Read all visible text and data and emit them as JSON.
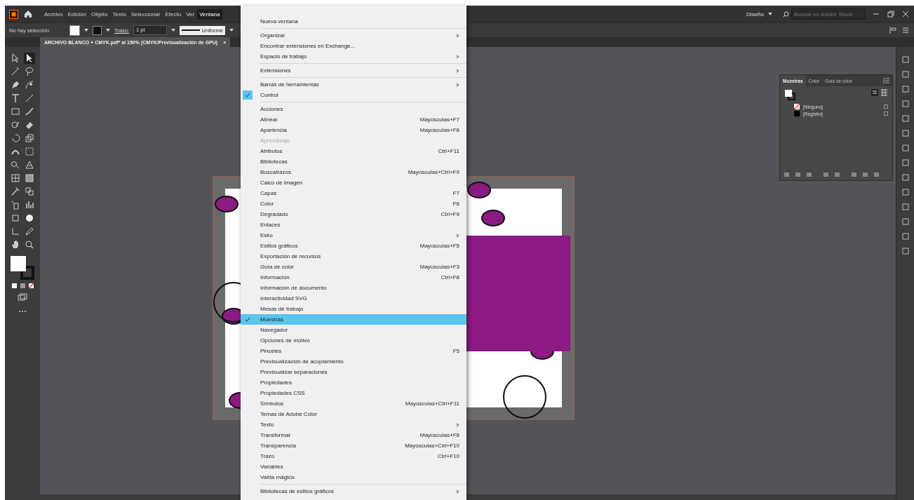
{
  "menubar": {
    "items": [
      {
        "label": "Archivo",
        "selected": false
      },
      {
        "label": "Edición",
        "selected": false
      },
      {
        "label": "Objeto",
        "selected": false
      },
      {
        "label": "Texto",
        "selected": false
      },
      {
        "label": "Seleccionar",
        "selected": false
      },
      {
        "label": "Efecto",
        "selected": false
      },
      {
        "label": "Ver",
        "selected": false
      },
      {
        "label": "Ventana",
        "selected": true
      }
    ],
    "workspace": "Diseño",
    "search": {
      "placeholder": "Buscar en Adobe Stock"
    }
  },
  "control_bar": {
    "selection": "No hay selección",
    "stroke_label": "Trazo:",
    "stroke_weight": "1 pt",
    "stroke_profile": "Uniforme"
  },
  "document_tab": {
    "title": "ARCHIVO BLANCO + CMYK.pdf* al 150% (CMYK/Previsualización de GPU)",
    "close": "×"
  },
  "swatches_panel": {
    "tabs": [
      {
        "label": "Muestras",
        "selected": true
      },
      {
        "label": "Color",
        "selected": false
      },
      {
        "label": "Guía de color",
        "selected": false
      }
    ],
    "swatches": [
      {
        "name": "[Ninguno]",
        "kind": "none"
      },
      {
        "name": "[Registro]",
        "kind": "registration"
      }
    ]
  },
  "window_menu": [
    {
      "kind": "item",
      "label": "Nueva ventana"
    },
    {
      "kind": "separator"
    },
    {
      "kind": "item",
      "label": "Organizar",
      "submenu": true
    },
    {
      "kind": "item",
      "label": "Encontrar extensiones en Exchange..."
    },
    {
      "kind": "item",
      "label": "Espacio de trabajo",
      "submenu": true
    },
    {
      "kind": "separator"
    },
    {
      "kind": "item",
      "label": "Extensiones",
      "submenu": true
    },
    {
      "kind": "separator"
    },
    {
      "kind": "item",
      "label": "Barras de herramientas",
      "submenu": true
    },
    {
      "kind": "item",
      "label": "Control",
      "checked": true
    },
    {
      "kind": "separator"
    },
    {
      "kind": "item",
      "label": "Acciones"
    },
    {
      "kind": "item",
      "label": "Alinear",
      "shortcut": "Mayúsculas+F7"
    },
    {
      "kind": "item",
      "label": "Apariencia",
      "shortcut": "Mayúsculas+F6"
    },
    {
      "kind": "item",
      "label": "Aprendizaje",
      "disabled": true
    },
    {
      "kind": "item",
      "label": "Atributos",
      "shortcut": "Ctrl+F11"
    },
    {
      "kind": "item",
      "label": "Bibliotecas"
    },
    {
      "kind": "item",
      "label": "Buscatrazos",
      "shortcut": "Mayúsculas+Ctrl+F9"
    },
    {
      "kind": "item",
      "label": "Calco de imagen"
    },
    {
      "kind": "item",
      "label": "Capas",
      "shortcut": "F7"
    },
    {
      "kind": "item",
      "label": "Color",
      "shortcut": "F6"
    },
    {
      "kind": "item",
      "label": "Degradado",
      "shortcut": "Ctrl+F9"
    },
    {
      "kind": "item",
      "label": "Enlaces"
    },
    {
      "kind": "item",
      "label": "Esko",
      "submenu": true
    },
    {
      "kind": "item",
      "label": "Estilos gráficos",
      "shortcut": "Mayúsculas+F5"
    },
    {
      "kind": "item",
      "label": "Exportación de recursos"
    },
    {
      "kind": "item",
      "label": "Guía de color",
      "shortcut": "Mayúsculas+F3"
    },
    {
      "kind": "item",
      "label": "Información",
      "shortcut": "Ctrl+F8"
    },
    {
      "kind": "item",
      "label": "Información de documento"
    },
    {
      "kind": "item",
      "label": "Interactividad SVG"
    },
    {
      "kind": "item",
      "label": "Mesas de trabajo"
    },
    {
      "kind": "item",
      "label": "Muestras",
      "checked": true,
      "selected": true
    },
    {
      "kind": "item",
      "label": "Navegador"
    },
    {
      "kind": "item",
      "label": "Opciones de motivo"
    },
    {
      "kind": "item",
      "label": "Pinceles",
      "shortcut": "F5"
    },
    {
      "kind": "item",
      "label": "Previsualización de acoplamiento"
    },
    {
      "kind": "item",
      "label": "Previsualizar separaciones"
    },
    {
      "kind": "item",
      "label": "Propiedades"
    },
    {
      "kind": "item",
      "label": "Propiedades CSS"
    },
    {
      "kind": "item",
      "label": "Símbolos",
      "shortcut": "Mayúsculas+Ctrl+F11"
    },
    {
      "kind": "item",
      "label": "Temas de Adobe Color"
    },
    {
      "kind": "item",
      "label": "Texto",
      "submenu": true
    },
    {
      "kind": "item",
      "label": "Transformar",
      "shortcut": "Mayúsculas+F8"
    },
    {
      "kind": "item",
      "label": "Transparencia",
      "shortcut": "Mayúsculas+Ctrl+F10"
    },
    {
      "kind": "item",
      "label": "Trazo",
      "shortcut": "Ctrl+F10"
    },
    {
      "kind": "item",
      "label": "Variables"
    },
    {
      "kind": "item",
      "label": "Varita mágica"
    },
    {
      "kind": "separator"
    },
    {
      "kind": "item",
      "label": "Bibliotecas de estilos gráficos",
      "submenu": true
    }
  ]
}
